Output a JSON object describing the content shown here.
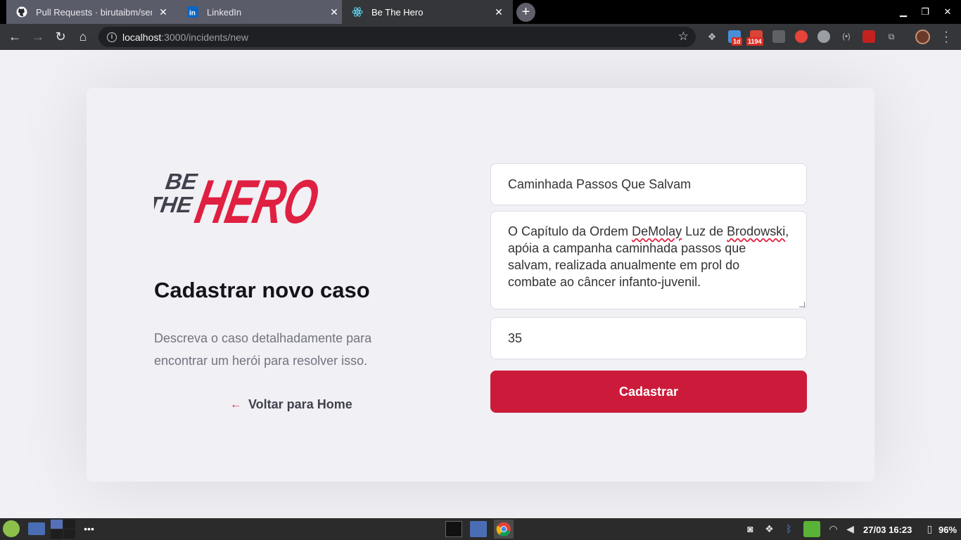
{
  "browser": {
    "tabs": [
      {
        "title": "Pull Requests · birutaibm/sem",
        "favicon": "github-icon",
        "active": false
      },
      {
        "title": "LinkedIn",
        "favicon": "linkedin-icon",
        "active": false
      },
      {
        "title": "Be The Hero",
        "favicon": "react-icon",
        "active": true
      }
    ],
    "url": {
      "host": "localhost",
      "path": ":3000/incidents/new"
    },
    "extension_badges": {
      "calendar": "1d",
      "mail": "1194"
    }
  },
  "page": {
    "logo": {
      "line1": "BE",
      "line2": "THE",
      "big": "HERO"
    },
    "heading": "Cadastrar novo caso",
    "description": "Descreva o caso detalhadamente para encontrar um herói para resolver isso.",
    "back_link": "Voltar para Home",
    "form": {
      "title_value": "Caminhada Passos Que Salvam",
      "description_parts": [
        "O Capítulo da Ordem ",
        "DeMolay",
        " Luz de ",
        "Brodowski",
        ", apóia a campanha caminhada passos que salvam, realizada anualmente em prol do combate ao câncer infanto-juvenil."
      ],
      "value": "35",
      "submit_label": "Cadastrar"
    },
    "colors": {
      "brand": "#e02041",
      "button": "#cc1b3a",
      "background": "#f0f0f5"
    }
  },
  "taskbar": {
    "clock": "27/03 16:23",
    "battery": "96%"
  }
}
